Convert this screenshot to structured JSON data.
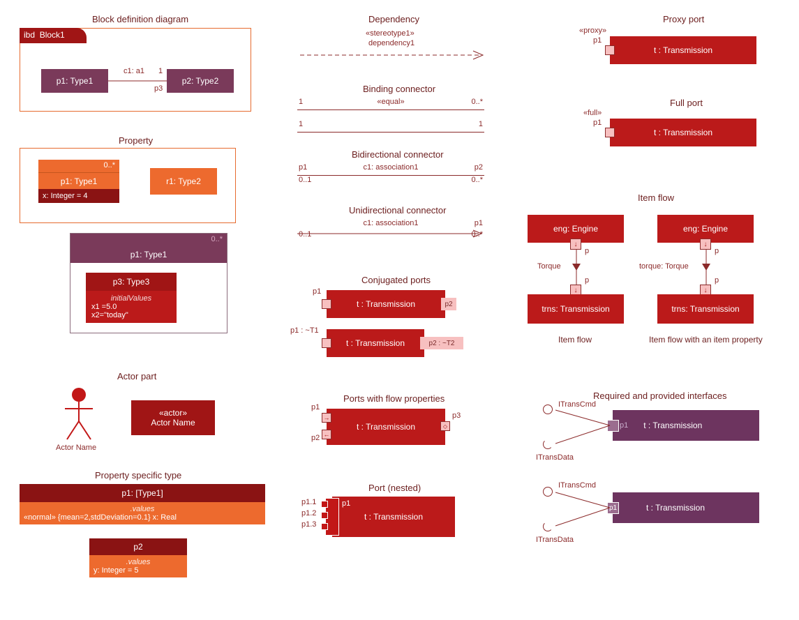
{
  "col1": {
    "bdd": {
      "title": "Block definition diagram",
      "ibd": "ibd",
      "block": "Block1",
      "p1": "p1: Type1",
      "p2": "p2: Type2",
      "conn": "c1: a1",
      "m1": "1",
      "m2": "p3"
    },
    "prop": {
      "title": "Property",
      "p1": "p1: Type1",
      "p1m": "0..*",
      "p1attr": "x: Integer = 4",
      "r1": "r1: Type2",
      "nested_p1": "p1: Type1",
      "nested_m": "0..*",
      "nested_p3": "p3: Type3",
      "iv": "initialValues",
      "iv1": "x1 =5.0",
      "iv2": "x2=\"today\""
    },
    "actor": {
      "title": "Actor part",
      "name": "Actor Name",
      "stereo": "«actor»",
      "name2": "Actor Name"
    },
    "pst": {
      "title": "Property specific type",
      "p1": "p1: [Type1]",
      "values": ".values",
      "expr": "«normal» {mean=2,stdDeviation=0.1} x: Real",
      "p2": "p2",
      "values2": ".values",
      "y": "y: Integer = 5"
    }
  },
  "col2": {
    "dep": {
      "title": "Dependency",
      "stereo": "«stereotype1»",
      "name": "dependency1"
    },
    "bind": {
      "title": "Binding connector",
      "eq": "«equal»",
      "tl": "1",
      "tr": "0..*",
      "bl": "1",
      "br": "1"
    },
    "bidir": {
      "title": "Bidirectional connector",
      "conn": "c1: association1",
      "tl": "p1",
      "tr": "p2",
      "bl": "0..1",
      "br": "0..*"
    },
    "uni": {
      "title": "Unidirectional connector",
      "conn": "c1: association1",
      "tr": "p1",
      "bl": "0..1",
      "br": "0..*"
    },
    "conj": {
      "title": "Conjugated ports",
      "txt1": "t : Transmission",
      "p1": "p1",
      "p2": "p2",
      "txt2": "t : Transmission",
      "p1b": "p1 : ~T1",
      "p2b": "p2 : ~T2"
    },
    "flowports": {
      "title": "Ports with flow properties",
      "txt": "t : Transmission",
      "p1": "p1",
      "p2": "p2",
      "p3": "p3"
    },
    "nested": {
      "title": "Port (nested)",
      "txt": "t : Transmission",
      "plabel": "p1",
      "p11": "p1.1",
      "p12": "p1.2",
      "p13": "p1.3"
    }
  },
  "col3": {
    "proxy": {
      "title": "Proxy port",
      "stereo": "«proxy»",
      "p": "p1",
      "txt": "t : Transmission"
    },
    "full": {
      "title": "Full port",
      "stereo": "«full»",
      "p": "p1",
      "txt": "t : Transmission"
    },
    "itemflow": {
      "title": "Item flow",
      "eng": "eng: Engine",
      "trns": "trns: Transmission",
      "pTop": "p",
      "pBot": "p",
      "flow1": "Torque",
      "flow2": "torque: Torque",
      "cap1": "Item flow",
      "cap2": "Item flow with an item property"
    },
    "iface": {
      "title": "Required and provided interfaces",
      "cmd": "ITransCmd",
      "data": "ITransData",
      "p": "p1",
      "txt": "t : Transmission"
    }
  }
}
